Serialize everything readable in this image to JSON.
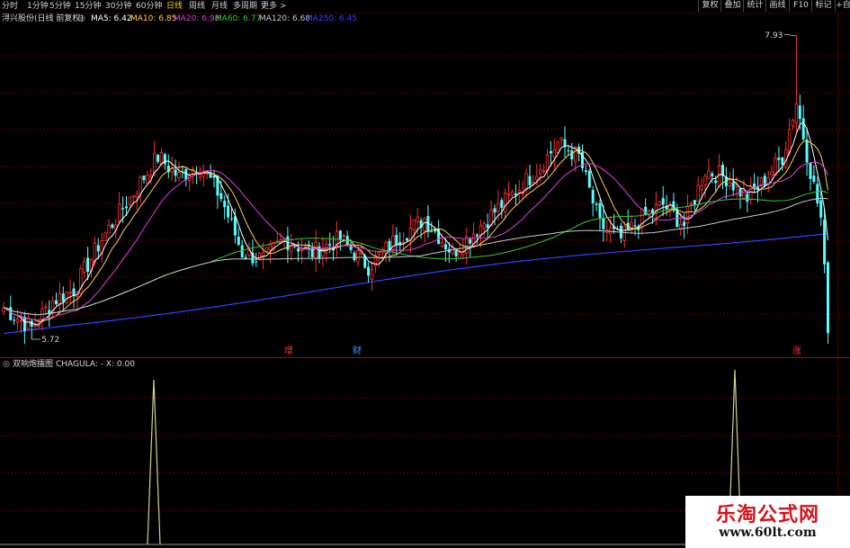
{
  "toolbar": {
    "periods": [
      "分时",
      "1分钟",
      "5分钟",
      "15分钟",
      "30分钟",
      "60分钟",
      "日线",
      "周线",
      "月线",
      "多周期",
      "更多"
    ],
    "active_period": "日线",
    "more_arrow": ">",
    "buttons": [
      "复权",
      "叠加",
      "统计",
      "画线",
      "F10",
      "标记"
    ],
    "corner": "+自"
  },
  "main_chart": {
    "stock_title": "浔兴股份(日线 前复权)",
    "ma": [
      {
        "label": "MA5: 6.42",
        "color": "#ffffff"
      },
      {
        "label": "MA10: 6.85",
        "color": "#ffd24a"
      },
      {
        "label": "MA20: 6.98",
        "color": "#e040e0"
      },
      {
        "label": "MA60: 6.77",
        "color": "#33cc33"
      },
      {
        "label": "MA120: 6.68",
        "color": "#c8c8c8"
      },
      {
        "label": "MA250: 6.45",
        "color": "#3344ff"
      }
    ],
    "high_label": "7.93",
    "low_label": "5.72",
    "markers": [
      {
        "text": "增",
        "color": "#ff3030"
      },
      {
        "text": "财",
        "color": "#3399ff"
      },
      {
        "text": "涨",
        "color": "#ff3030"
      }
    ],
    "colors": {
      "up": "#ff3030",
      "down": "#54ffff",
      "grid": "#6e0000",
      "background": "#000000"
    }
  },
  "indicator": {
    "name": "双响炮擂图",
    "formula_label": "CHAGULA: - X: 0.00",
    "line_color": "#d2d28c"
  },
  "watermark": {
    "title": "乐淘公式网",
    "url": "www.60lt.com"
  }
}
